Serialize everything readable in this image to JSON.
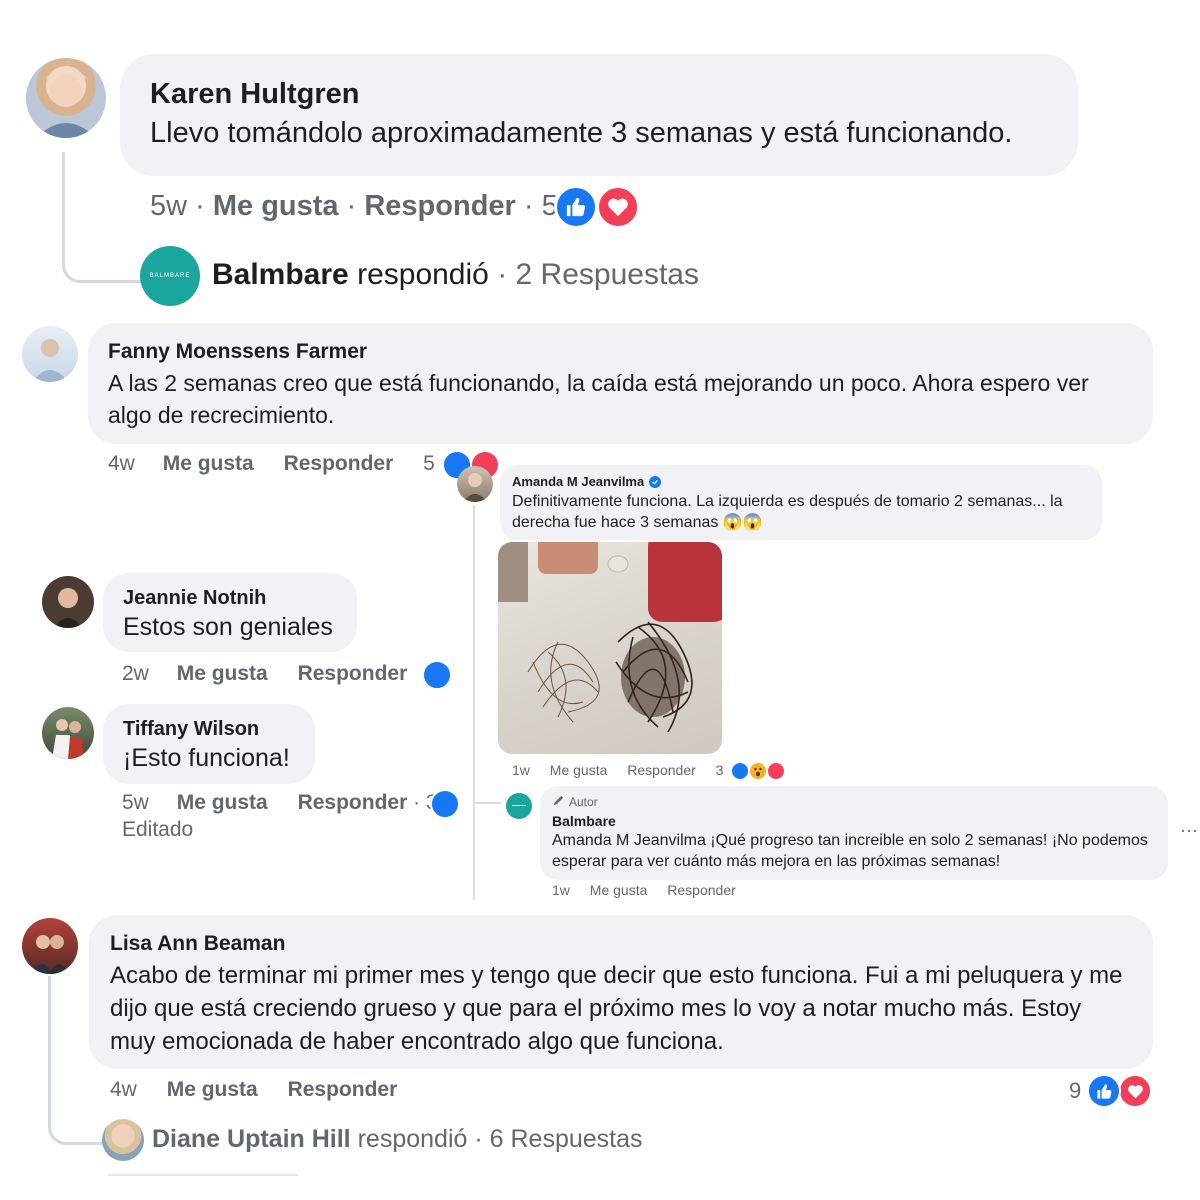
{
  "colors": {
    "like": "#1877f2",
    "love": "#f33e58",
    "wow": "#f7b125",
    "bubble": "#f0f2f5",
    "brand_teal": "#1aa69e"
  },
  "comments": {
    "karen": {
      "name": "Karen Hultgren",
      "text": "Llevo tomándolo aproximadamente 3 semanas y está funcionando.",
      "time": "5w",
      "like_label": "Me gusta",
      "reply_label": "Responder",
      "reaction_count": "5",
      "sep": "·"
    },
    "balmbare_reply": {
      "avatar_text": "BALMBARE",
      "name": "Balmbare",
      "verb": "respondió",
      "sep": "·",
      "count": "2 Respuestas"
    },
    "fanny": {
      "name": "Fanny Moenssens Farmer",
      "text": "A las 2 semanas creo que está funcionando, la caída está mejorando un poco. Ahora espero ver algo de recrecimiento.",
      "time": "4w",
      "like_label": "Me gusta",
      "reply_label": "Responder",
      "reaction_count": "5"
    },
    "amanda": {
      "name": "Amanda M Jeanvilma",
      "text": "Definitivamente funciona. La izquierda es después de tomario 2 semanas... la derecha fue hace 3 semanas 😱😱",
      "time": "1w",
      "like_label": "Me gusta",
      "reply_label": "Responder",
      "reaction_count": "3"
    },
    "balmbare_author": {
      "badge": "Autor",
      "name": "Balmbare",
      "text": "Amanda M Jeanvilma ¡Qué progreso tan increible en solo 2 semanas! ¡No podemos esperar para ver cuánto más mejora en las próximas semanas!",
      "time": "1w",
      "like_label": "Me gusta",
      "reply_label": "Responder",
      "more": "···"
    },
    "jeannie": {
      "name": "Jeannie Notnih",
      "text": "Estos son geniales",
      "time": "2w",
      "like_label": "Me gusta",
      "reply_label": "Responder"
    },
    "tiffany": {
      "name": "Tiffany Wilson",
      "text": "¡Esto funciona!",
      "time": "5w",
      "like_label": "Me gusta",
      "reply_label": "Responder",
      "reaction_count": "· 3",
      "edited": "Editado"
    },
    "lisa": {
      "name": "Lisa Ann Beaman",
      "text": "Acabo de terminar mi primer mes y tengo que decir que esto funciona. Fui a mi peluquera y me dijo que está creciendo grueso y que para el próximo mes lo voy a notar mucho más. Estoy muy emocionada de haber encontrado algo que funciona.",
      "time": "4w",
      "like_label": "Me gusta",
      "reply_label": "Responder",
      "reaction_count": "9"
    },
    "diane_reply": {
      "name": "Diane Uptain Hill",
      "verb": "respondió",
      "sep": "·",
      "count": "6 Respuestas"
    }
  },
  "icons": {
    "like": "thumbs-up-icon",
    "love": "heart-icon",
    "wow": "wow-face-icon",
    "verified": "verified-check-icon",
    "author": "pencil-icon"
  }
}
